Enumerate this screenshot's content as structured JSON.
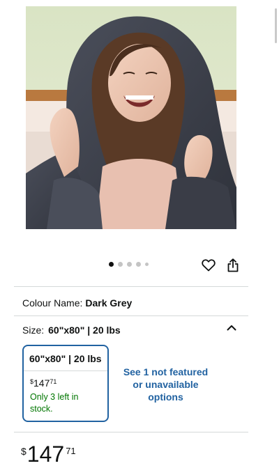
{
  "gallery": {
    "dots_total": 5,
    "active_dot": 0
  },
  "colour": {
    "label": "Colour Name:",
    "value": "Dark Grey"
  },
  "size": {
    "label": "Size:",
    "value": "60\"x80\" | 20 lbs"
  },
  "option": {
    "title": "60\"x80\" | 20 lbs",
    "currency": "$",
    "price_whole": "147",
    "price_fraction": "71",
    "stock_line1": "Only 3 left in",
    "stock_line2": "stock."
  },
  "see_more": {
    "line1": "See 1 not featured",
    "line2": "or unavailable",
    "line3": "options"
  },
  "price": {
    "currency": "$",
    "whole": "147",
    "fraction": "71"
  },
  "colors": {
    "link": "#2162a1",
    "in_stock": "#007600",
    "divider": "#d5d9d9"
  },
  "icons": [
    "heart-icon",
    "share-icon",
    "chevron-up-icon"
  ]
}
